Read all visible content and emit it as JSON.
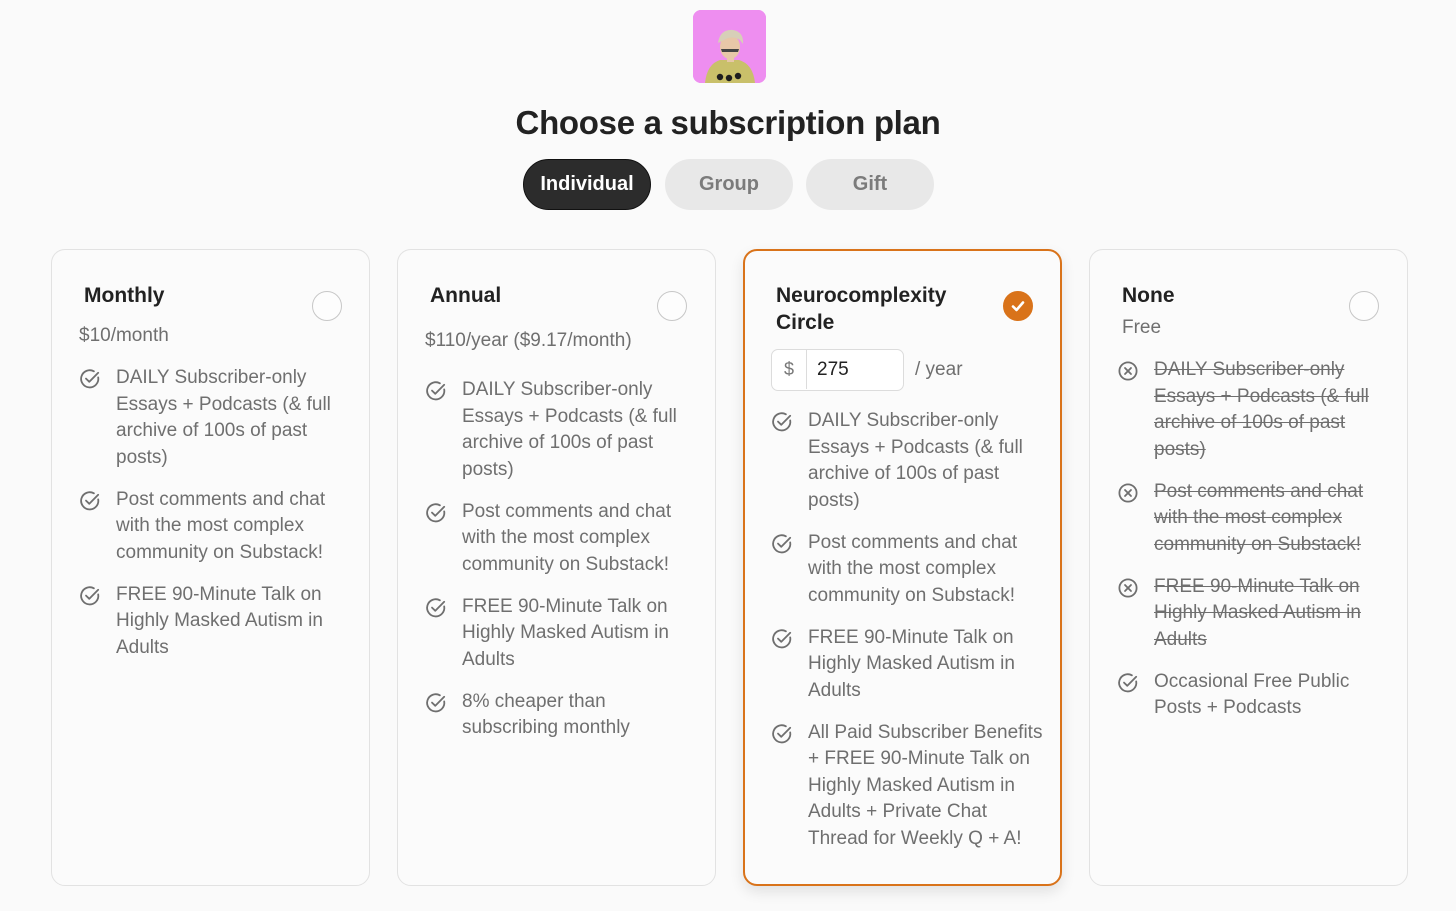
{
  "header": {
    "avatar": "avatar-photo",
    "title": "Choose a subscription plan"
  },
  "tabs": [
    {
      "label": "Individual",
      "active": true
    },
    {
      "label": "Group",
      "active": false
    },
    {
      "label": "Gift",
      "active": false
    }
  ],
  "colors": {
    "accent": "#d9731a",
    "active_tab_bg": "#2c2c2c",
    "avatar_bg": "#ee8ef0"
  },
  "plans": [
    {
      "name": "Monthly",
      "price": "$10/month",
      "selected": false,
      "features": [
        {
          "icon": "check-circle-icon",
          "text": "DAILY Subscriber-only Essays + Podcasts (& full archive of 100s of past posts)",
          "struck": false
        },
        {
          "icon": "check-circle-icon",
          "text": "Post comments and chat with the most complex community on Substack!",
          "struck": false
        },
        {
          "icon": "check-circle-icon",
          "text": "FREE 90-Minute Talk on Highly Masked Autism in Adults",
          "struck": false
        }
      ]
    },
    {
      "name": "Annual",
      "price": "$110/year ($9.17/month)",
      "selected": false,
      "features": [
        {
          "icon": "check-circle-icon",
          "text": "DAILY Subscriber-only Essays + Podcasts (& full archive of 100s of past posts)",
          "struck": false
        },
        {
          "icon": "check-circle-icon",
          "text": "Post comments and chat with the most complex community on Substack!",
          "struck": false
        },
        {
          "icon": "check-circle-icon",
          "text": "FREE 90-Minute Talk on Highly Masked Autism in Adults",
          "struck": false
        },
        {
          "icon": "check-circle-icon",
          "text": "8% cheaper than subscribing monthly",
          "struck": false
        }
      ]
    },
    {
      "name": "Neurocomplexity Circle",
      "currency_symbol": "$",
      "amount": "275",
      "period": "/ year",
      "selected": true,
      "features": [
        {
          "icon": "check-circle-icon",
          "text": "DAILY Subscriber-only Essays + Podcasts (& full archive of 100s of past posts)",
          "struck": false
        },
        {
          "icon": "check-circle-icon",
          "text": "Post comments and chat with the most complex community on Substack!",
          "struck": false
        },
        {
          "icon": "check-circle-icon",
          "text": "FREE 90-Minute Talk on Highly Masked Autism in Adults",
          "struck": false
        },
        {
          "icon": "check-circle-icon",
          "text": "All Paid Subscriber Benefits + FREE 90-Minute Talk on Highly Masked Autism in Adults + Private Chat Thread for Weekly Q + A!",
          "struck": false
        }
      ]
    },
    {
      "name": "None",
      "price": "Free",
      "selected": false,
      "features": [
        {
          "icon": "x-circle-icon",
          "text": "DAILY Subscriber-only Essays + Podcasts (& full archive of 100s of past posts)",
          "struck": true
        },
        {
          "icon": "x-circle-icon",
          "text": "Post comments and chat with the most complex community on Substack!",
          "struck": true
        },
        {
          "icon": "x-circle-icon",
          "text": "FREE 90-Minute Talk on Highly Masked Autism in Adults",
          "struck": true
        },
        {
          "icon": "check-circle-icon",
          "text": "Occasional Free Public Posts + Podcasts",
          "struck": false
        }
      ]
    }
  ]
}
